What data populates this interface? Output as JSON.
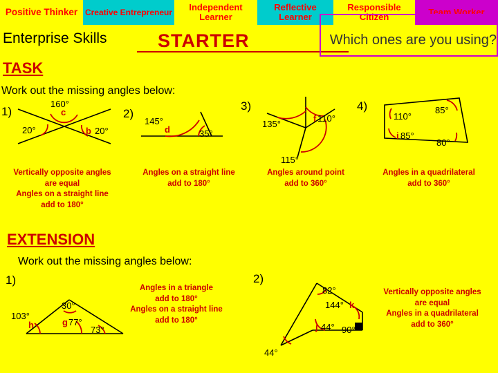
{
  "banner": {
    "cells": [
      {
        "label": "Positive Thinker"
      },
      {
        "label": "Creative Entrepreneur"
      },
      {
        "label": "Independent Learner"
      },
      {
        "label": "Reflective Learner"
      },
      {
        "label": "Responsible Citizen"
      },
      {
        "label": "Team Worker"
      }
    ]
  },
  "header": {
    "enterprise": "Enterprise Skills",
    "starter": "STARTER",
    "which_ones": "Which ones are you using?",
    "task": "TASK",
    "instruction": "Work out the missing angles below:"
  },
  "task_questions": [
    {
      "number": "1)",
      "angles": [
        "160°",
        "20°",
        "20°"
      ],
      "letters": [
        "c",
        "b"
      ],
      "note": "Vertically opposite angles are equal\nAngles on a straight line add to 180°"
    },
    {
      "number": "2)",
      "angles": [
        "145°",
        "35°"
      ],
      "letters": [
        "d"
      ],
      "note": "Angles on a straight line add to 180°"
    },
    {
      "number": "3)",
      "angles": [
        "135°",
        "110°",
        "115°"
      ],
      "letters": [
        "f"
      ],
      "note": "Angles around point add to 360°"
    },
    {
      "number": "4)",
      "angles": [
        "110°",
        "85°",
        "85°",
        "80°"
      ],
      "letters": [
        "i"
      ],
      "note": "Angles in a quadrilateral add to 360°"
    }
  ],
  "extension": {
    "title": "EXTENSION",
    "instruction": "Work out the missing angles below:",
    "questions": [
      {
        "number": "1)",
        "angles": [
          "103°",
          "30°",
          "77°",
          "73°"
        ],
        "letters": [
          "h",
          "g"
        ],
        "note": "Angles in a triangle add to 180°\nAngles on a straight line add to 180°"
      },
      {
        "number": "2)",
        "angles": [
          "82°",
          "144°",
          "44°",
          "90°",
          "44°"
        ],
        "letters": [
          "k",
          "j"
        ],
        "note": "Vertically opposite angles are equal\nAngles in a quadrilateral add to 360°"
      }
    ]
  },
  "notes": {
    "n1": "Vertically opposite angles",
    "n1b": "are equal",
    "n1c": "Angles on a straight line",
    "n1d": "add to 180°",
    "n2a": "Angles on a straight line",
    "n2b": "add to 180°",
    "n3a": "Angles around  point",
    "n3b": "add to 360°",
    "n4a": "Angles in a quadrilateral",
    "n4b": "add to 360°",
    "e1a": "Angles in a triangle",
    "e1b": "add to 180°",
    "e1c": "Angles on a straight line",
    "e1d": "add to 180°",
    "e2a": "Vertically opposite angles",
    "e2b": "are equal",
    "e2c": "Angles in a quadrilateral",
    "e2d": "add to 360°"
  },
  "labels": {
    "q1": "1)",
    "q2": "2)",
    "q3": "3)",
    "q4": "4)",
    "e1": "1)",
    "e2": "2)",
    "a160": "160°",
    "a20a": "20°",
    "a20b": "20°",
    "lc": "c",
    "lb": "b",
    "a145": "145°",
    "a35": "35°",
    "ld": "d",
    "a135": "135°",
    "a110f": "110°",
    "a115": "115°",
    "lf": "f",
    "a110q": "110°",
    "a85a": "85°",
    "a85b": "85°",
    "a80": "80°",
    "li": "i",
    "a103": "103°",
    "a30": "30°",
    "a77": "77°",
    "a73": "73°",
    "lh": "h",
    "lg": "g",
    "a82": "82°",
    "a144": "144°",
    "a44a": "44°",
    "a90": "90°",
    "a44b": "44°",
    "lk": "k",
    "lj": "j"
  }
}
